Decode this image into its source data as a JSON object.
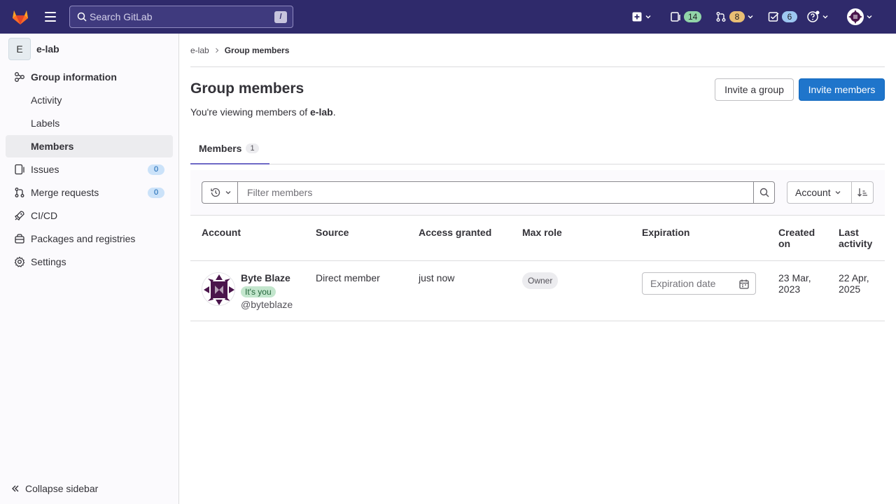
{
  "topbar": {
    "search_placeholder": "Search GitLab",
    "search_shortcut": "/",
    "issues_count": "14",
    "merge_requests_count": "8",
    "todos_count": "6"
  },
  "sidebar": {
    "group_initial": "E",
    "group_name": "e-lab",
    "items": [
      {
        "label": "Group information"
      },
      {
        "label": "Activity"
      },
      {
        "label": "Labels"
      },
      {
        "label": "Members"
      },
      {
        "label": "Issues",
        "count": "0"
      },
      {
        "label": "Merge requests",
        "count": "0"
      },
      {
        "label": "CI/CD"
      },
      {
        "label": "Packages and registries"
      },
      {
        "label": "Settings"
      }
    ],
    "collapse_label": "Collapse sidebar"
  },
  "breadcrumb": {
    "parent": "e-lab",
    "current": "Group members"
  },
  "page": {
    "title": "Group members",
    "subtitle_prefix": "You're viewing members of ",
    "subtitle_group": "e-lab",
    "subtitle_suffix": ".",
    "invite_group_label": "Invite a group",
    "invite_members_label": "Invite members"
  },
  "tabs": [
    {
      "label": "Members",
      "count": "1"
    }
  ],
  "filter": {
    "placeholder": "Filter members",
    "sort_label": "Account"
  },
  "table": {
    "columns": [
      "Account",
      "Source",
      "Access granted",
      "Max role",
      "Expiration",
      "Created on",
      "Last activity"
    ],
    "rows": [
      {
        "name": "Byte Blaze",
        "you_badge": "It's you",
        "handle": "@byteblaze",
        "source": "Direct member",
        "access_granted": "just now",
        "max_role": "Owner",
        "expiration_placeholder": "Expiration date",
        "created_on": "23 Mar, 2023",
        "last_activity": "22 Apr, 2025"
      }
    ]
  }
}
